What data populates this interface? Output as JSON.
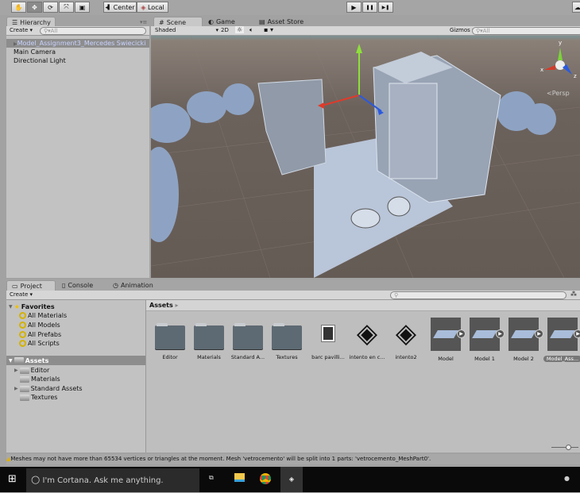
{
  "toolbar": {
    "tools": [
      "hand-icon",
      "move-icon",
      "rotate-icon",
      "scale-icon",
      "rect-icon"
    ],
    "pivot": "Center",
    "space": "Local",
    "play": "▶",
    "pause": "❚❚",
    "step": "▶❚"
  },
  "hierarchy": {
    "tab": "Hierarchy",
    "create": "Create",
    "search_placeholder": "All",
    "items": [
      "Model_Assignment3_Mercedes Swiecicki",
      "Main Camera",
      "Directional Light"
    ]
  },
  "scene": {
    "tabs": [
      "Scene",
      "Game",
      "Asset Store"
    ],
    "shading": "Shaded",
    "mode2d": "2D",
    "gizmos": "Gizmos",
    "search_placeholder": "All",
    "persp": "Persp",
    "axis": {
      "x": "x",
      "y": "y",
      "z": "z"
    }
  },
  "project": {
    "tabs": [
      "Project",
      "Console",
      "Animation"
    ],
    "create": "Create",
    "favorites": {
      "label": "Favorites",
      "items": [
        "All Materials",
        "All Models",
        "All Prefabs",
        "All Scripts"
      ]
    },
    "assets_tree": {
      "label": "Assets",
      "items": [
        "Editor",
        "Materials",
        "Standard Assets",
        "Textures"
      ]
    },
    "breadcrumb": "Assets",
    "grid": [
      {
        "name": "Editor",
        "type": "folder"
      },
      {
        "name": "Materials",
        "type": "folder"
      },
      {
        "name": "Standard A...",
        "type": "folder"
      },
      {
        "name": "Textures",
        "type": "folder"
      },
      {
        "name": "barc pavilli...",
        "type": "image"
      },
      {
        "name": "intento en c...",
        "type": "unity"
      },
      {
        "name": "intento2",
        "type": "unity"
      },
      {
        "name": "Model",
        "type": "model"
      },
      {
        "name": "Model 1",
        "type": "model"
      },
      {
        "name": "Model 2",
        "type": "model"
      },
      {
        "name": "Model_Ass...",
        "type": "model"
      }
    ]
  },
  "status": "Meshes may not have more than 65534 vertices or triangles at the moment. Mesh 'vetrocemento' will be split into 1 parts: 'vetrocemento_MeshPart0'.",
  "taskbar": {
    "cortana": "I'm Cortana. Ask me anything."
  }
}
